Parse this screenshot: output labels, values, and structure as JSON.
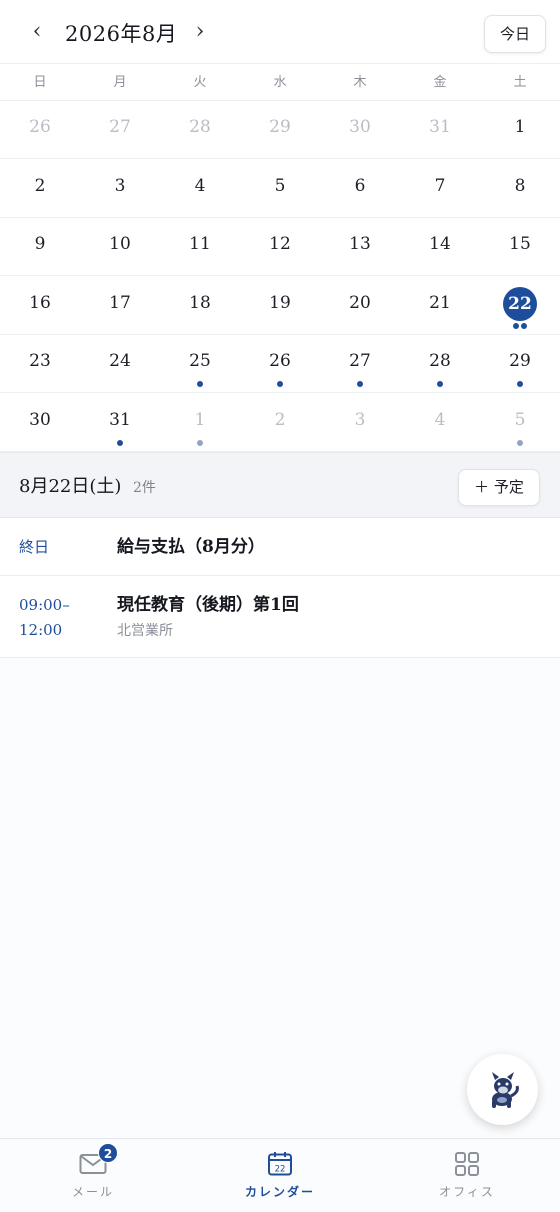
{
  "header": {
    "prev_icon": "‹",
    "next_icon": "›",
    "month_title": "2026年8月",
    "today_label": "今日"
  },
  "weekdays": [
    "日",
    "月",
    "火",
    "水",
    "木",
    "金",
    "土"
  ],
  "weeks": [
    [
      {
        "n": "26",
        "other": true
      },
      {
        "n": "27",
        "other": true
      },
      {
        "n": "28",
        "other": true
      },
      {
        "n": "29",
        "other": true
      },
      {
        "n": "30",
        "other": true
      },
      {
        "n": "31",
        "other": true
      },
      {
        "n": "1"
      }
    ],
    [
      {
        "n": "2"
      },
      {
        "n": "3"
      },
      {
        "n": "4"
      },
      {
        "n": "5"
      },
      {
        "n": "6"
      },
      {
        "n": "7"
      },
      {
        "n": "8"
      }
    ],
    [
      {
        "n": "9"
      },
      {
        "n": "10"
      },
      {
        "n": "11"
      },
      {
        "n": "12"
      },
      {
        "n": "13"
      },
      {
        "n": "14"
      },
      {
        "n": "15"
      }
    ],
    [
      {
        "n": "16"
      },
      {
        "n": "17"
      },
      {
        "n": "18"
      },
      {
        "n": "19"
      },
      {
        "n": "20"
      },
      {
        "n": "21"
      },
      {
        "n": "22",
        "selected": true,
        "dots": 2
      }
    ],
    [
      {
        "n": "23"
      },
      {
        "n": "24"
      },
      {
        "n": "25",
        "dots": 1
      },
      {
        "n": "26",
        "dots": 1
      },
      {
        "n": "27",
        "dots": 1
      },
      {
        "n": "28",
        "dots": 1
      },
      {
        "n": "29",
        "dots": 1
      }
    ],
    [
      {
        "n": "30"
      },
      {
        "n": "31",
        "dots": 1
      },
      {
        "n": "1",
        "other": true,
        "dots": 1
      },
      {
        "n": "2",
        "other": true
      },
      {
        "n": "3",
        "other": true
      },
      {
        "n": "4",
        "other": true
      },
      {
        "n": "5",
        "other": true,
        "dots": 1
      }
    ]
  ],
  "agenda": {
    "date_label": "8月22日(土)",
    "count_label": "2件",
    "add_label": "＋ 予定",
    "events": [
      {
        "time": "終日",
        "title": "給与支払（8月分）"
      },
      {
        "time_start": "09:00–",
        "time_end": "12:00",
        "title": "現任教育（後期）第1回",
        "location": "北営業所"
      }
    ]
  },
  "fab": {
    "icon": "dog-mascot-icon"
  },
  "tabs": [
    {
      "label": "メール",
      "icon": "mail-icon",
      "badge": "2",
      "active": false
    },
    {
      "label": "カレンダー",
      "icon": "calendar-icon",
      "icon_text": "22",
      "active": true
    },
    {
      "label": "オフィス",
      "icon": "grid-icon",
      "active": false
    }
  ],
  "colors": {
    "accent": "#1e4e9b",
    "muted": "#8b9099",
    "other_month": "#b9bdc4"
  }
}
